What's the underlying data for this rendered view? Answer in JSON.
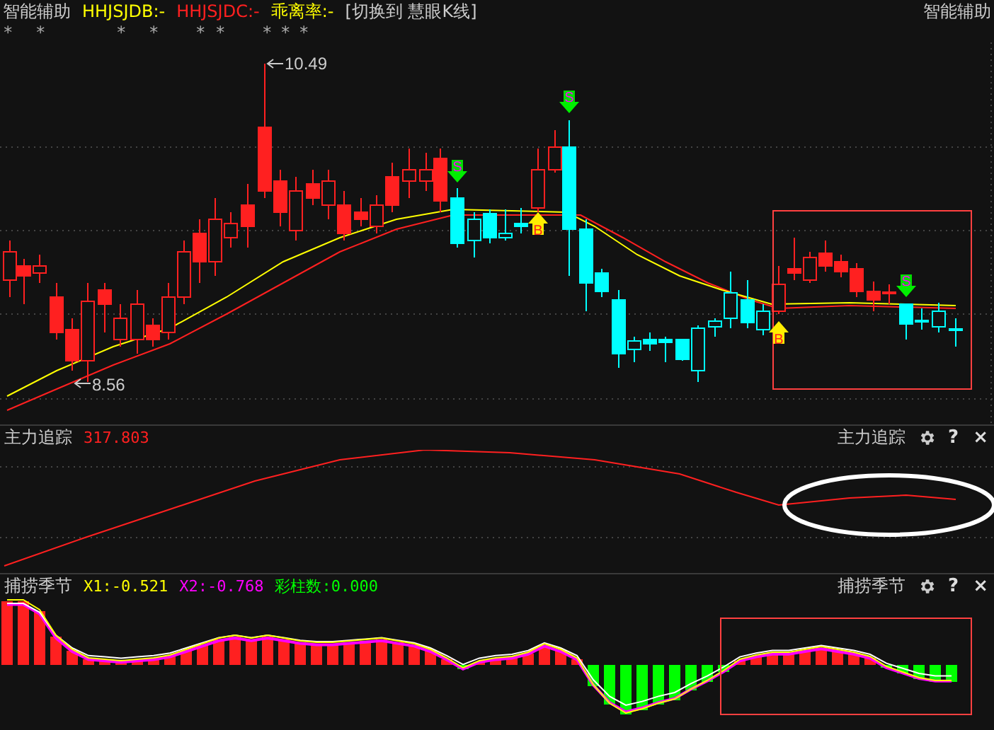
{
  "header": {
    "title": "智能辅助",
    "fields": [
      {
        "text": "HHJSJDB:-",
        "color": "#ffff00"
      },
      {
        "text": "HHJSJDC:-",
        "color": "#ff2020"
      },
      {
        "text": "乖离率:-",
        "color": "#ffff00"
      }
    ],
    "switch_link": "[切换到 慧眼K线]",
    "right_title": "智能辅助",
    "stars": [
      "*",
      "*",
      "*",
      "*",
      "*",
      "*",
      "*",
      "*",
      "*"
    ]
  },
  "price_chart": {
    "high_label": "10.49",
    "low_label": "8.56",
    "signals": [
      {
        "kind": "sell",
        "label": "S"
      },
      {
        "kind": "buy",
        "label": "B"
      },
      {
        "kind": "sell",
        "label": "S"
      },
      {
        "kind": "buy",
        "label": "B"
      },
      {
        "kind": "sell",
        "label": "S"
      }
    ]
  },
  "panels": [
    {
      "title": "主力追踪",
      "values": [
        {
          "text": "317.803",
          "color": "#ff2020"
        }
      ],
      "right_title": "主力追踪",
      "help": "?",
      "close": "×"
    },
    {
      "title": "捕捞季节",
      "values": [
        {
          "text": "X1:-0.521",
          "color": "#ffff00"
        },
        {
          "text": "X2:-0.768",
          "color": "#ff00ff"
        },
        {
          "text": "彩柱数:0.000",
          "color": "#00ff00"
        }
      ],
      "right_title": "捕捞季节",
      "help": "?",
      "close": "×"
    }
  ]
}
